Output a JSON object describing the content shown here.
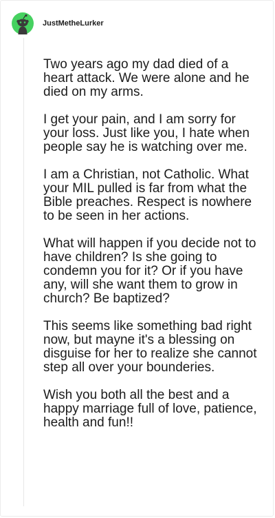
{
  "comment": {
    "author": "JustMetheLurker",
    "avatar_icon": "snoo-avatar-icon",
    "avatar_color": "#46d160",
    "paragraphs": [
      "Two years ago my dad died of a heart attack. We were alone and he died on my arms.",
      "I get your pain, and I am sorry for your loss. Just like you, I hate when people say he is watching over me.",
      "I am a Christian, not Catholic. What your MIL pulled is far from what the Bible preaches. Respect is nowhere to be seen in her actions.",
      "What will happen if you decide not to have children? Is she going to condemn you for it? Or if you have any, will she want them to grow in church? Be baptized?",
      "This seems like something bad right now, but mayne it's a blessing on disguise for her to realize she cannot step all over your bounderies.",
      "Wish you both all the best and a happy marriage full of love, patience, health and fun!!"
    ]
  }
}
